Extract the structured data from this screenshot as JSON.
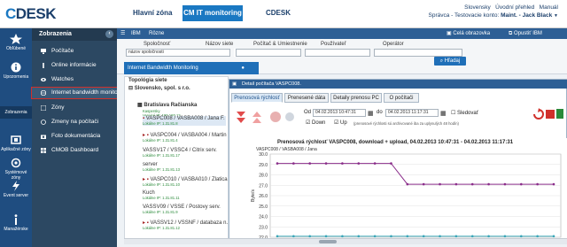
{
  "app": {
    "logo_c": "C",
    "logo_rest": "DESK"
  },
  "topnav": {
    "item1": "Hlavní zóna",
    "item2": "CM IT monitoring",
    "item3": "CDESK"
  },
  "user": {
    "line1_a": "Slovensky",
    "line1_b": "Úvodní přehled",
    "line1_c": "Manuál",
    "line2": "Správca - Testovacie konto:",
    "line2_name": "Maint. - Jack Black"
  },
  "leftnav": [
    {
      "label": "Obľúbené",
      "icon": "star-icon"
    },
    {
      "label": "Upozornenia",
      "icon": "info-icon"
    },
    {
      "label": "Zobrazenia",
      "icon": "view-icon"
    },
    {
      "label": "Aplikačné zóny",
      "icon": "app-zones-icon"
    },
    {
      "label": "Systémové zóny",
      "icon": "system-zones-icon"
    },
    {
      "label": "Event server",
      "icon": "event-server-icon"
    },
    {
      "label": "Manažérske",
      "icon": "manager-icon"
    }
  ],
  "menu": {
    "header": "Zobrazenia",
    "items": [
      "Počítače",
      "Online informácie",
      "Watches",
      "Internet bandwidth monitor",
      "Zóny",
      "Zmeny na počítači",
      "Foto dokumentácia",
      "CMOB Dashboard"
    ]
  },
  "content": {
    "toolbar_ibm": "IBM",
    "toolbar_rozne": "Rôzne",
    "full_screen": "Celá obrazovka",
    "opustit": "Opustiť IBM"
  },
  "filters": {
    "label1": "Spoločnosť",
    "value1": "názov spoločnosti",
    "label2": "Názov siete",
    "label3": "Počítač & Umiestnenie",
    "label4": "Používateľ",
    "label5": "Operátor",
    "search_btn": "Hľadaj"
  },
  "popup": {
    "title": "Internet Bandwidth Monitoring"
  },
  "tree": {
    "header": "Topológia siete",
    "company": "Slovensko, spol. s r.o.",
    "branch": "Bratislava Račianska",
    "nodes": [
      {
        "name": "Kaspersky",
        "ip": "Verejné IP: 190.180.12"
      },
      {
        "name": "VASPC008 / VASBA008 / Jana F.",
        "ip": "Lokálne IP: 1.31.81.8"
      },
      {
        "name": "VASPC004 / VASBA004 / Martin",
        "ip": "Lokálne IP: 1.31.81.4"
      },
      {
        "name": "VASSV17 / VSSC4 / Citrix serv.",
        "ip": "Lokálne IP: 1.31.81.17"
      },
      {
        "name": "server",
        "ip": "Lokálne IP: 1.31.81.13"
      },
      {
        "name": "VASPC010 / VASBA010 / Zlatica",
        "ip": "Lokálne IP: 1.31.81.10"
      },
      {
        "name": "Kuch",
        "ip": "Lokálne IP: 1.31.81.11"
      },
      {
        "name": "VASSV09 / VSSE / Postovy serv.",
        "ip": "Lokálne IP: 1.31.81.9"
      },
      {
        "name": "VASSV12 / VSSNF / databaza n.",
        "ip": "Lokálne IP: 1.31.81.12"
      }
    ]
  },
  "detail": {
    "title": "Detail počítača VASPC008.",
    "tabs": [
      "Prenosová rýchlosť",
      "Prenesené dáta",
      "Detaily prenosu PC",
      "O počítači"
    ],
    "from_label": "Od",
    "from_date": "04.02.2013 10:47:31",
    "to_label": "do",
    "to_date": "04.02.2013 11:17:31",
    "sledovat": "Sledovať",
    "down": "Down",
    "up": "Up",
    "note": "(prenosové rýchlosti sú archivované iba za uplynulých 48 hodín)"
  },
  "chart_data": {
    "type": "line",
    "title": "Prenosová rýchlosť VASPC008, download + upload, 04.02.2013 10:47:31 - 04.02.2013 11:17:31",
    "legend": "VASPC008 / VASBA008 / Jana",
    "ylabel": "Byte/s",
    "ylim": [
      22.0,
      30.0
    ],
    "yticks": [
      "30.0",
      "29.0",
      "28.0",
      "27.0",
      "26.0",
      "25.0",
      "24.0",
      "23.0",
      "22.0"
    ],
    "series": [
      {
        "name": "download",
        "color": "#8a2d8a",
        "values": [
          29.1,
          29.1,
          29.1,
          29.1,
          29.1,
          29.1,
          29.1,
          29.1,
          27.1,
          27.1,
          27.1,
          27.1,
          27.1,
          27.1,
          27.1,
          27.1,
          27.1,
          27.1
        ]
      },
      {
        "name": "upload",
        "color": "#3aa6b8",
        "values": [
          22.1,
          22.1,
          22.1,
          22.1,
          22.1,
          22.1,
          22.1,
          22.1,
          22.1,
          22.1,
          22.1,
          22.1,
          22.1,
          22.1,
          22.1,
          22.1,
          22.1,
          22.1
        ]
      }
    ]
  }
}
